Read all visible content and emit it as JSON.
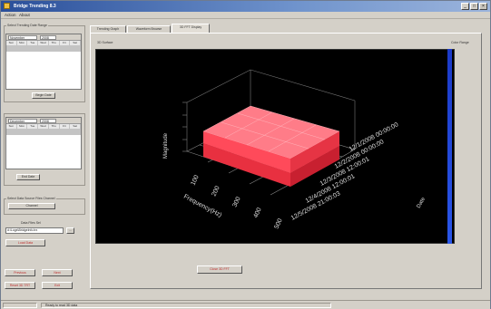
{
  "window": {
    "title": "Bridge Trending 8.3"
  },
  "menu": [
    "Action",
    "About"
  ],
  "left": {
    "range_group_label": "Select Trending Date Range",
    "cal1": {
      "month": "November",
      "year": "2008",
      "weekdays": [
        "Sun",
        "Mon",
        "Tue",
        "Wed",
        "Thu",
        "Fri",
        "Sat"
      ],
      "selected_index": 23
    },
    "begin_button": "Begin Date",
    "cal2": {
      "month": "December",
      "year": "2008",
      "weekdays": [
        "Sun",
        "Mon",
        "Tue",
        "Wed",
        "Thu",
        "Fri",
        "Sat"
      ],
      "selected_index": 21
    },
    "end_button": "End Date",
    "channel_group_label": "Select Data Source Files Channel",
    "channel_button": "Channel",
    "file_label": "Data Files Sel",
    "file_value": "d:\\Logs\\BridgeInfo.trx",
    "file_browse": "...",
    "load_button": "Load Data",
    "btn_a": "Previous",
    "btn_b": "Next",
    "btn_reset": "Reset 3D TRT",
    "btn_exit": "Exit"
  },
  "tabs": [
    "Trending Graph",
    "Waveform Browse",
    "3D FFT Display"
  ],
  "active_tab": 2,
  "panel": {
    "plot_caption": "3D Surface",
    "colorbar_label": "Color Range",
    "close_button": "Close 3D FFT"
  },
  "plot": {
    "z_label": "Magnitude",
    "x_label": "Frequency(Hz)",
    "x_ticks": [
      "100",
      "200",
      "300",
      "400",
      "500"
    ],
    "y_ticks": [
      "12/1/2008 00:00:00",
      "12/2/2008 00:00:00",
      "12/3/2008 12:00:01",
      "12/4/2008 12:00:01",
      "12/5/2008 21:00:03"
    ],
    "y_label": "Date",
    "surface_color": "#ff4a5a"
  },
  "status": {
    "message": "Ready to read 3D data"
  }
}
